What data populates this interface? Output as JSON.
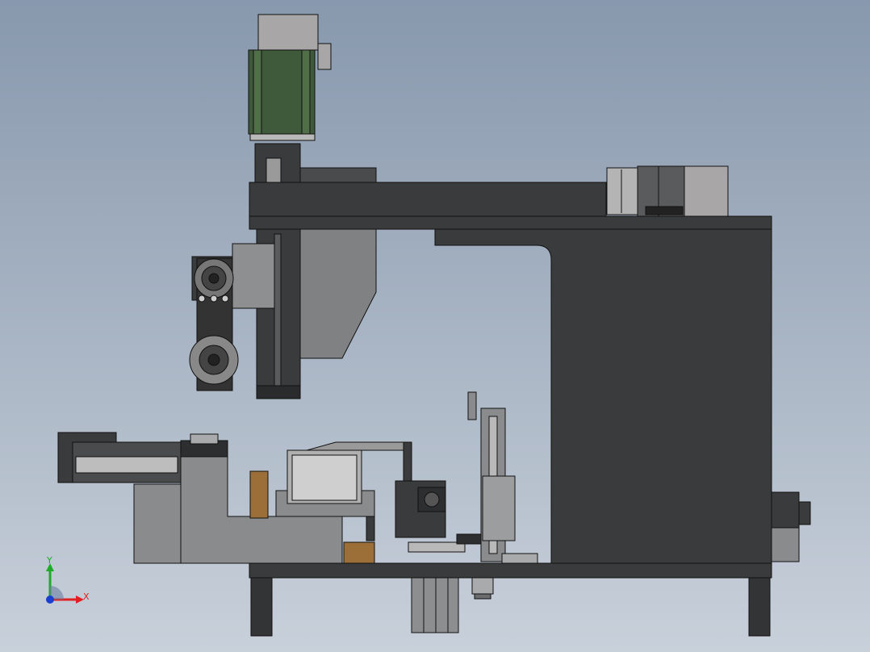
{
  "viewport": {
    "background_top": "#8898ad",
    "background_bottom": "#c8d0da"
  },
  "colors": {
    "frame_dark": "#3a3b3d",
    "frame_outline": "#111111",
    "part_gray": "#8a8b8c",
    "part_light": "#b9b9b9",
    "motor_green": "#3f5a3a",
    "motor_cap": "#a8a6a6",
    "wood_block": "#9c6e38",
    "axis_x": "#e02020",
    "axis_y": "#1faa2a",
    "axis_z": "#1a3fd0"
  },
  "triad": {
    "x_label": "X",
    "y_label": "Y"
  }
}
